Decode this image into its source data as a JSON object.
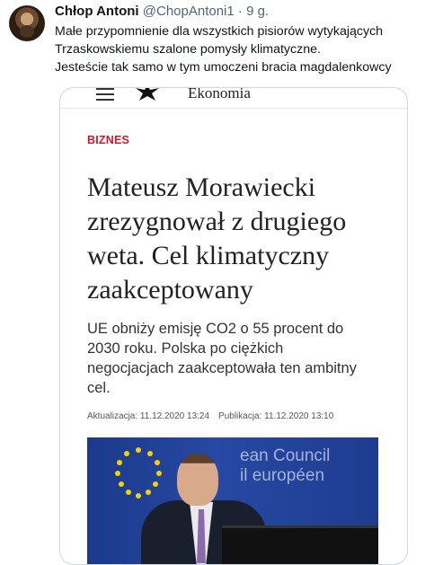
{
  "tweet": {
    "author_name": "Chłop Antoni",
    "handle": "@ChopAntoni1",
    "separator": "·",
    "time": "9 g.",
    "text_lines": [
      "Małe przypomnienie dla wszystkich pisiorów wytykających",
      "Trzaskowskiemu szalone pomysły klimatyczne.",
      "Jesteście tak samo w tym umoczeni bracia magdalenkowcy"
    ]
  },
  "article": {
    "section": "Ekonomia",
    "category": "BIZNES",
    "headline_lines": [
      "Mateusz Morawiecki",
      "zrezygnował z drugiego",
      "weta. Cel klimatyczny",
      "zaakceptowany"
    ],
    "lead_lines": [
      "UE obniży emisję CO2 o 55 procent do",
      "2030 roku. Polska po ciężkich",
      "negocjacjach zaakceptowała ten ambitny",
      "cel."
    ],
    "updated": "Aktualizacja: 11.12.2020 13:24",
    "published": "Publikacja: 11.12.2020 13:10",
    "photo_text_lines": [
      "ean Council",
      "il européen"
    ]
  },
  "colors": {
    "category": "#c81b2e",
    "secondary_text": "#536471",
    "photo_background": "#2748a3"
  }
}
